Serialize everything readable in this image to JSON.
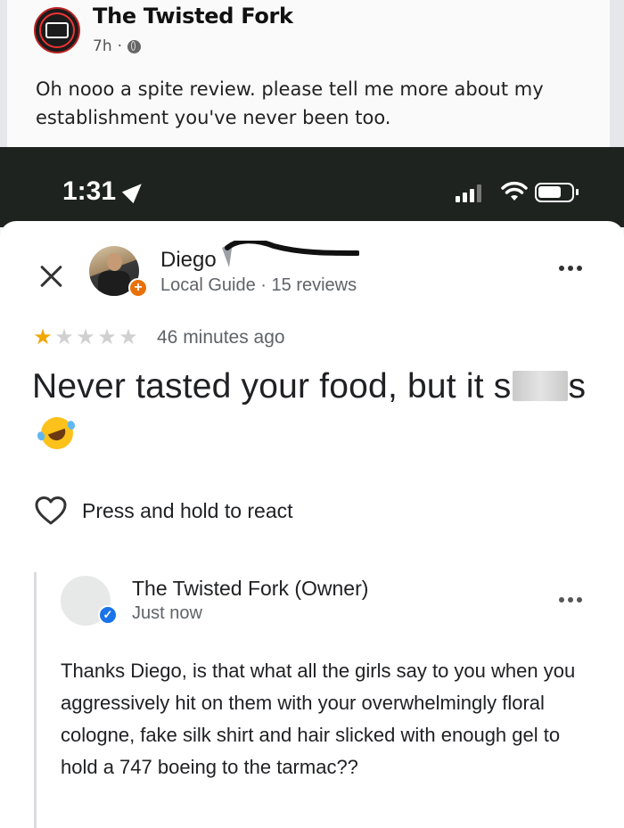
{
  "fb_post": {
    "page_name": "The Twisted Fork",
    "time_ago": "7h",
    "separator": "·",
    "audience_icon": "globe-icon",
    "text": "Oh nooo a spite review. please tell me more about my establishment you've never been too."
  },
  "status_bar": {
    "time": "1:31",
    "location_icon": "location-arrow-icon",
    "signal_icon": "signal-icon",
    "wifi_icon": "wifi-icon",
    "battery_icon": "battery-icon"
  },
  "review": {
    "close_icon": "close-icon",
    "reviewer_name": "Diego",
    "reviewer_meta": "Local Guide · 15 reviews",
    "more_icon": "more-options-icon",
    "rating": 1,
    "rating_max": 5,
    "time_ago": "46 minutes ago",
    "text_part1": "Never tasted your food, but it s",
    "text_part2": "s",
    "emoji": "rolling-on-floor-laughing-emoji",
    "react_label": "Press and hold to react"
  },
  "owner_reply": {
    "name": "The Twisted Fork (Owner)",
    "time": "Just now",
    "text": "Thanks Diego, is that what all the girls say to you when you aggressively hit on them with your overwhelmingly floral cologne, fake silk shirt and hair slicked with enough gel to hold a 747 boeing to the tarmac??"
  },
  "colors": {
    "star_filled": "#f2a600",
    "star_empty": "#d0d0d0",
    "status_bar_bg": "#1e2320",
    "verified_blue": "#1a73e8",
    "local_guide_orange": "#e8710a"
  }
}
